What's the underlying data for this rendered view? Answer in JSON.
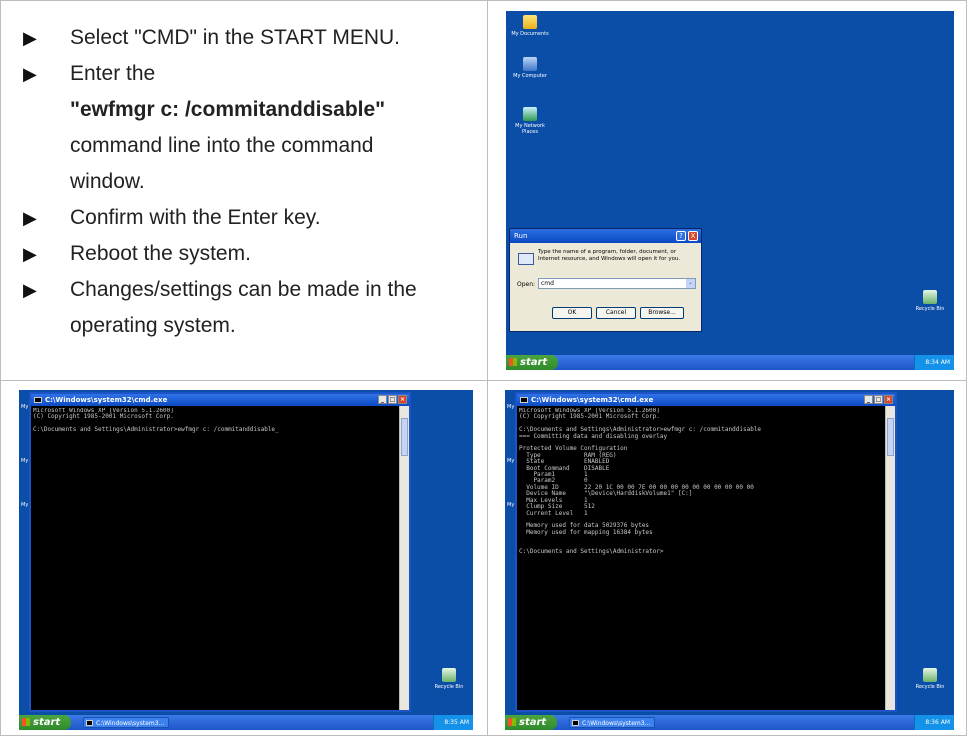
{
  "instructions": {
    "steps": [
      {
        "text": "Select \"CMD\" in the START MENU."
      },
      {
        "lines": [
          "Enter the",
          "\"ewfmgr c: /commitanddisable\"",
          "command line into the command",
          "window."
        ]
      },
      {
        "text": "Confirm with the Enter key."
      },
      {
        "text": "Reboot the system."
      },
      {
        "lines": [
          "Changes/settings can be made in the",
          "operating system."
        ]
      }
    ],
    "arrow_glyph": "▶"
  },
  "desktop": {
    "icons": [
      "My Documents",
      "My Computer",
      "My Network Places"
    ],
    "recycle_bin": "Recycle Bin",
    "start_label": "start",
    "edge_label": "My"
  },
  "run_dialog": {
    "title": "Run",
    "help_glyph": "?",
    "close_glyph": "X",
    "description": "Type the name of a program, folder, document, or Internet resource, and Windows will open it for you.",
    "open_label": "Open:",
    "open_value": "cmd",
    "dropdown_glyph": "⌄",
    "ok": "OK",
    "cancel": "Cancel",
    "browse": "Browse..."
  },
  "screens": {
    "run_clock": "8:34 AM",
    "cmd1_clock": "8:35 AM",
    "cmd2_clock": "8:36 AM",
    "taskbar_item": "C:\\Windows\\system3..."
  },
  "cmd_window": {
    "title": "C:\\Windows\\system32\\cmd.exe",
    "min": "_",
    "max": "□",
    "close": "×",
    "output1": "Microsoft Windows XP [Version 5.1.2600]\n(C) Copyright 1985-2001 Microsoft Corp.\n\nC:\\Documents and Settings\\Administrator>ewfmgr c: /commitanddisable_",
    "output2": "Microsoft Windows XP [Version 5.1.2600]\n(C) Copyright 1985-2001 Microsoft Corp.\n\nC:\\Documents and Settings\\Administrator>ewfmgr c: /commitanddisable\n=== Committing data and disabling overlay\n\nProtected Volume Configuration\n  Type            RAM (REG)\n  State           ENABLED\n  Boot Command    DISABLE\n    Param1        1\n    Param2        0\n  Volume ID       22 20 1C 00 00 7E 00 00 00 00 00 00 00 00 00 00\n  Device Name     \"\\Device\\HarddiskVolume1\" [C:]\n  Max Levels      1\n  Clump Size      512\n  Current Level   1\n\n  Memory used for data 5029376 bytes\n  Memory used for mapping 16384 bytes\n\n\nC:\\Documents and Settings\\Administrator>"
  }
}
